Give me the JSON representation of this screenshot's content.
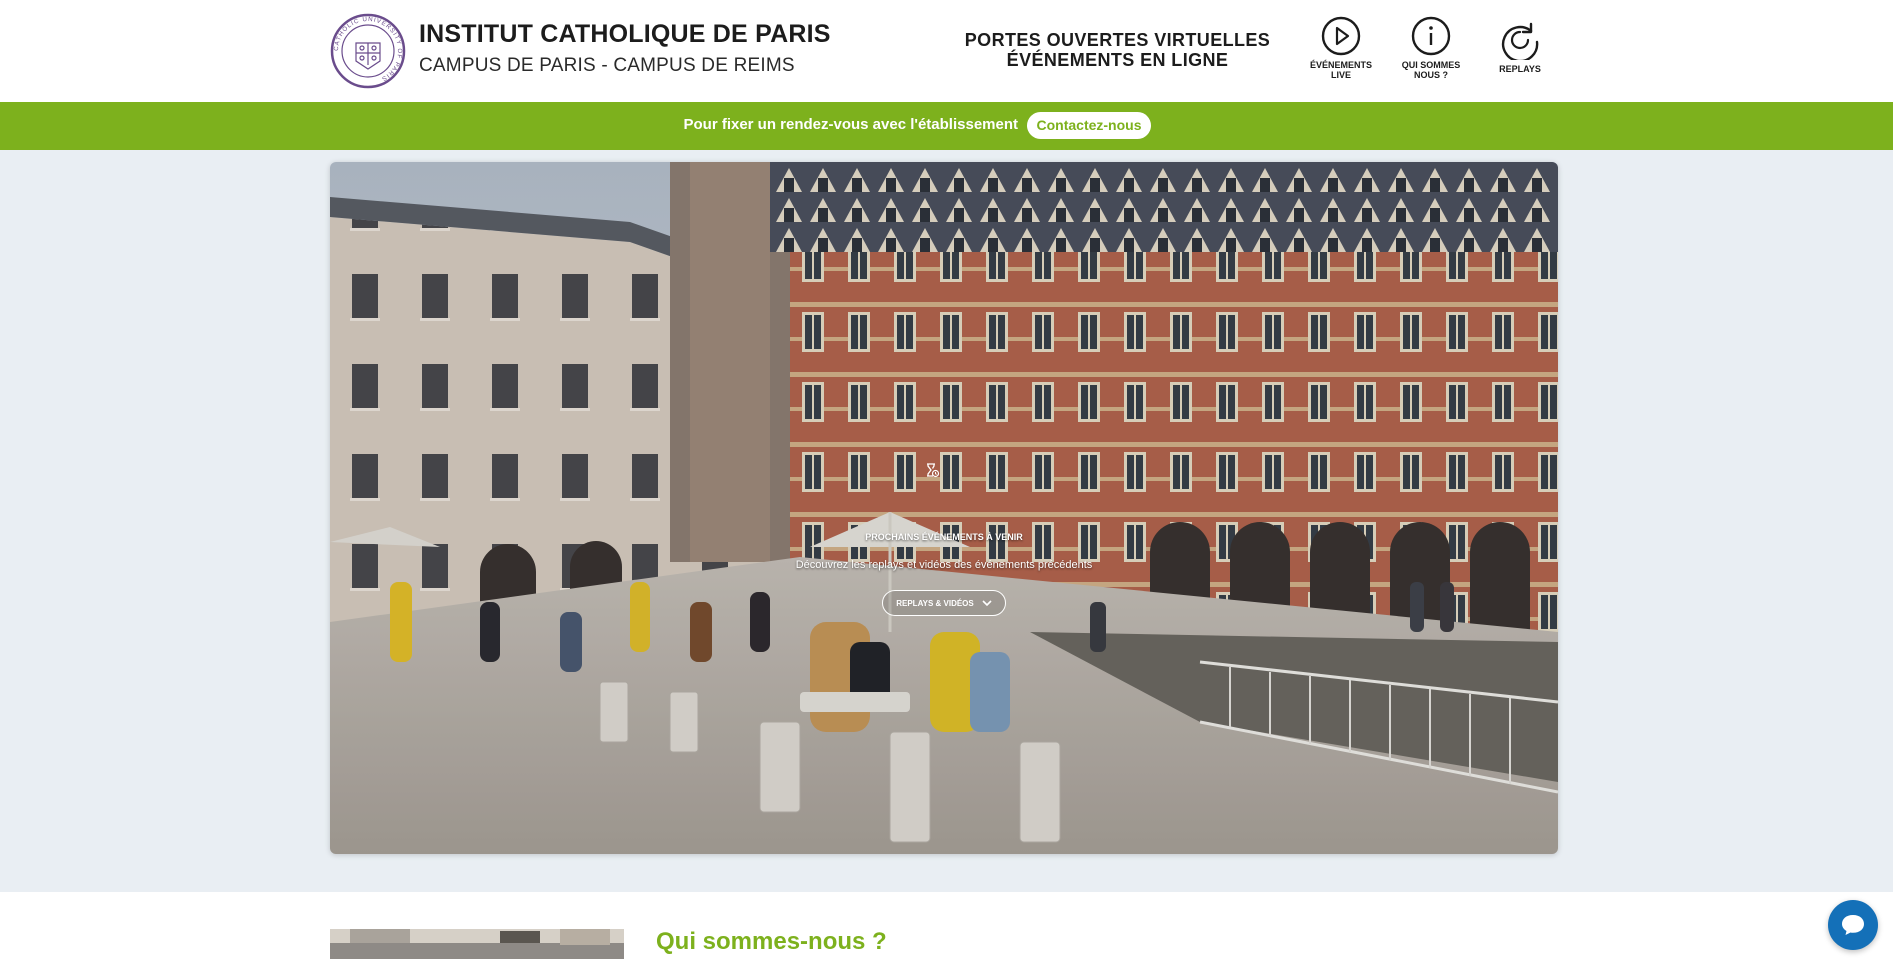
{
  "header": {
    "site_title": "INSTITUT CATHOLIQUE DE PARIS",
    "site_subtitle": "CAMPUS DE PARIS - CAMPUS DE REIMS",
    "event_title_line1": "PORTES OUVERTES VIRTUELLES",
    "event_title_line2": "ÉVÉNEMENTS EN LIGNE",
    "logo_icon": "university-seal-icon",
    "logo_text": "CATHOLIC UNIVERSITY OF PARIS",
    "nav": [
      {
        "label_line1": "ÉVÉNEMENTS",
        "label_line2": "LIVE",
        "icon": "play-circle-icon"
      },
      {
        "label_line1": "QUI SOMMES",
        "label_line2": "NOUS ?",
        "icon": "info-circle-icon"
      },
      {
        "label_line1": "REPLAYS",
        "label_line2": "",
        "icon": "replay-icon"
      }
    ]
  },
  "banner": {
    "text": "Pour fixer un rendez-vous avec l'établissement",
    "button_label": "Contactez-nous"
  },
  "hero": {
    "heading": "PROCHAINS ÉVÉNEMENTS À VENIR",
    "text": "Découvrez les replays et vidéos des événements précédents",
    "button_label": "REPLAYS & VIDÉOS",
    "button_icon": "chevron-down-icon",
    "icon": "hourglass-icon"
  },
  "section": {
    "heading": "Qui sommes-nous ?"
  },
  "chat": {
    "icon": "chat-bubble-icon"
  },
  "colors": {
    "brand_green": "#7db11d",
    "seal_purple": "#6a4c8c",
    "chat_blue": "#1470b8"
  }
}
